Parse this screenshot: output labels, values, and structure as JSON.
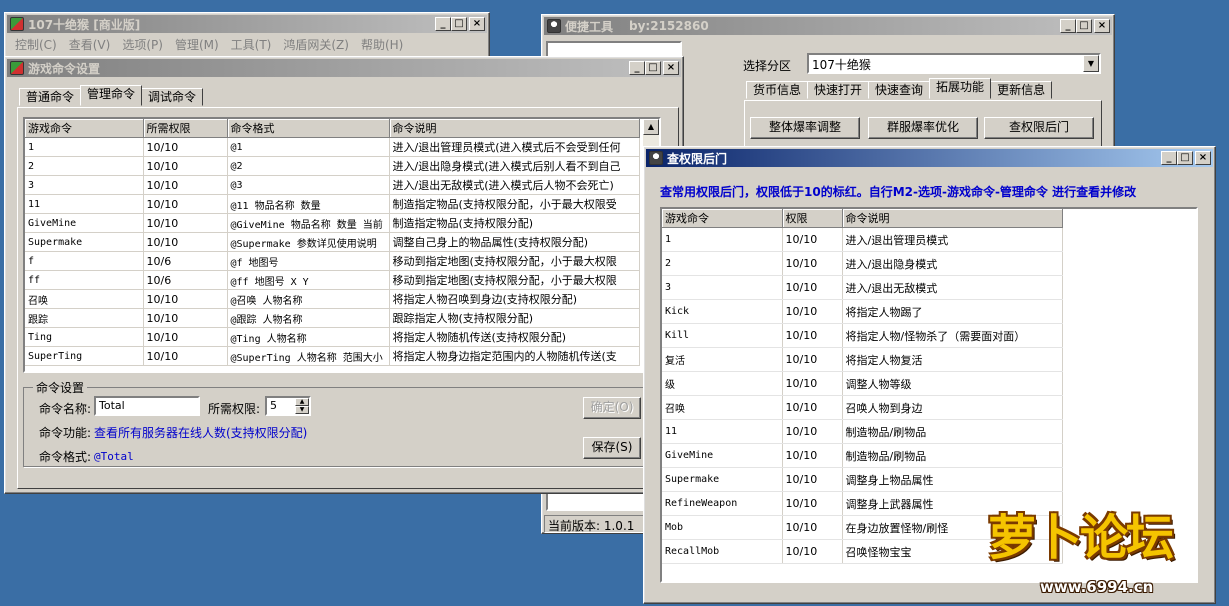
{
  "main_window": {
    "title": "107十绝猴 [商业版]",
    "menu": [
      "控制(C)",
      "查看(V)",
      "选项(P)",
      "管理(M)",
      "工具(T)",
      "鸿盾网关(Z)",
      "帮助(H)"
    ]
  },
  "cmd_window": {
    "title": "游戏命令设置",
    "tabs": [
      "普通命令",
      "管理命令",
      "调试命令"
    ],
    "columns": [
      "游戏命令",
      "所需权限",
      "命令格式",
      "命令说明"
    ],
    "rows": [
      [
        "1",
        "10/10",
        "@1",
        "进入/退出管理员模式(进入模式后不会受到任何"
      ],
      [
        "2",
        "10/10",
        "@2",
        "进入/退出隐身模式(进入模式后别人看不到自己"
      ],
      [
        "3",
        "10/10",
        "@3",
        "进入/退出无敌模式(进入模式后人物不会死亡)"
      ],
      [
        "11",
        "10/10",
        "@11 物品名称 数量",
        "制造指定物品(支持权限分配，小于最大权限受"
      ],
      [
        "GiveMine",
        "10/10",
        "@GiveMine 物品名称 数量 当前",
        "制造指定物品(支持权限分配)"
      ],
      [
        "Supermake",
        "10/10",
        "@Supermake 参数详见使用说明",
        "调整自己身上的物品属性(支持权限分配)"
      ],
      [
        "f",
        "10/6",
        "@f 地图号",
        "移动到指定地图(支持权限分配，小于最大权限"
      ],
      [
        "ff",
        "10/6",
        "@ff 地图号 X Y",
        "移动到指定地图(支持权限分配，小于最大权限"
      ],
      [
        "召唤",
        "10/10",
        "@召唤 人物名称",
        "将指定人物召唤到身边(支持权限分配)"
      ],
      [
        "跟踪",
        "10/10",
        "@跟踪 人物名称",
        "跟踪指定人物(支持权限分配)"
      ],
      [
        "Ting",
        "10/10",
        "@Ting 人物名称",
        "将指定人物随机传送(支持权限分配)"
      ],
      [
        "SuperTing",
        "10/10",
        "@SuperTing 人物名称 范围大小",
        "将指定人物身边指定范围内的人物随机传送(支"
      ]
    ],
    "settings": {
      "group_label": "命令设置",
      "name_label": "命令名称:",
      "name_value": "Total",
      "perm_label": "所需权限:",
      "perm_value": "5",
      "func_label": "命令功能:",
      "func_value": "查看所有服务器在线人数(支持权限分配)",
      "format_label": "命令格式:",
      "format_value": "@Total",
      "ok_label": "确定(O)",
      "save_label": "保存(S)"
    }
  },
  "tools_window": {
    "title": "便捷工具",
    "author": "by:2152860",
    "zone_label": "选择分区",
    "zone_value": "107十绝猴",
    "tabs": [
      "货币信息",
      "快速打开",
      "快速查询",
      "拓展功能",
      "更新信息"
    ],
    "buttons": [
      "整体爆率调整",
      "群服爆率优化",
      "查权限后门"
    ],
    "version": "当前版本: 1.0.1"
  },
  "perm_window": {
    "title": "查权限后门",
    "notice": "查常用权限后门，权限低于10的标红。自行M2-选项-游戏命令-管理命令 进行查看并修改",
    "columns": [
      "游戏命令",
      "权限",
      "命令说明"
    ],
    "rows": [
      [
        "1",
        "10/10",
        "进入/退出管理员模式"
      ],
      [
        "2",
        "10/10",
        "进入/退出隐身模式"
      ],
      [
        "3",
        "10/10",
        "进入/退出无敌模式"
      ],
      [
        "Kick",
        "10/10",
        "将指定人物踢了"
      ],
      [
        "Kill",
        "10/10",
        "将指定人物/怪物杀了（需要面对面）"
      ],
      [
        "复活",
        "10/10",
        "将指定人物复活"
      ],
      [
        "级",
        "10/10",
        "调整人物等级"
      ],
      [
        "召唤",
        "10/10",
        "召唤人物到身边"
      ],
      [
        "11",
        "10/10",
        "制造物品/刷物品"
      ],
      [
        "GiveMine",
        "10/10",
        "制造物品/刷物品"
      ],
      [
        "Supermake",
        "10/10",
        "调整身上物品属性"
      ],
      [
        "RefineWeapon",
        "10/10",
        "调整身上武器属性"
      ],
      [
        "Mob",
        "10/10",
        "在身边放置怪物/刷怪"
      ],
      [
        "RecallMob",
        "10/10",
        "召唤怪物宝宝"
      ]
    ]
  },
  "watermark": {
    "logo_text": "萝卜论坛",
    "url": "www.6994.cn"
  },
  "colors": {
    "desktop": "#3a6ea5",
    "active_title": "#0a246a",
    "notice_text": "#0000cc",
    "func_text": "#0000cc"
  }
}
